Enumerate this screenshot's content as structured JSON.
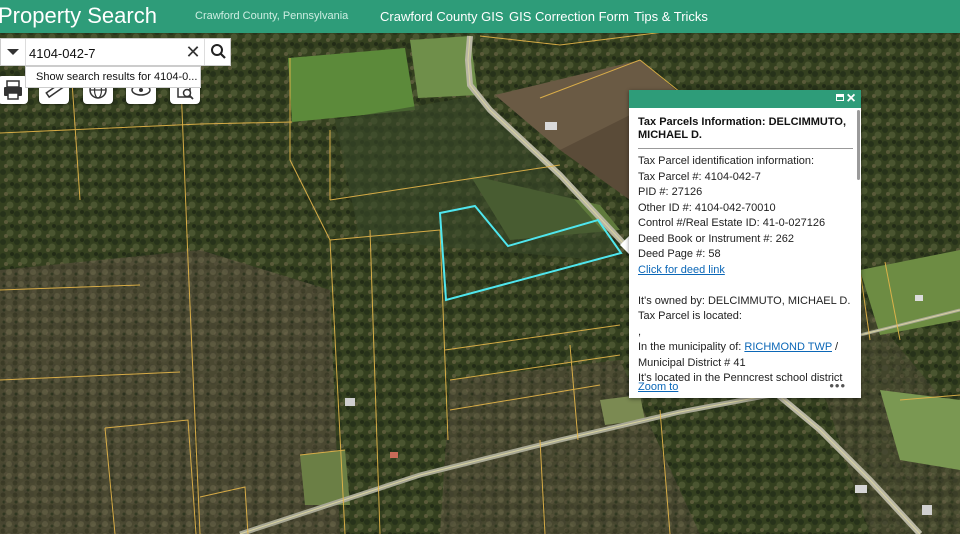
{
  "header": {
    "app_title": "Property Search",
    "subtitle": "Crawford County, Pennsylvania",
    "nav": [
      "Crawford County GIS",
      "GIS Correction Form",
      "Tips & Tricks"
    ],
    "accent": "#2e9c79"
  },
  "search": {
    "value": "4104-042-7",
    "clear_glyph": "✕",
    "suggestion": "Show search results for 4104-0..."
  },
  "tools": [
    "print-icon",
    "measure-icon",
    "basemap-icon",
    "layers-icon",
    "query-icon"
  ],
  "popup": {
    "title": "Tax Parcels Information: DELCIMMUTO, MICHAEL D.",
    "lines": {
      "heading": "Tax Parcel identification information:",
      "tax_parcel_label": "Tax Parcel #: ",
      "tax_parcel_value": "4104-042-7",
      "pid_label": "PID #: ",
      "pid_value": "27126",
      "other_id_label": "Other ID #: ",
      "other_id_value": "4104-042-70010",
      "control_label": "Control #/Real Estate ID: ",
      "control_value": "41-0-027126",
      "deed_book_label": "Deed Book or Instrument #: ",
      "deed_book_value": "262",
      "deed_page_label": "Deed Page #: ",
      "deed_page_value": "58",
      "deed_link": "Click for deed link",
      "owner_label": "It's owned by: ",
      "owner_value": "DELCIMMUTO, MICHAEL D.",
      "located_label": "Tax Parcel is located:",
      "comma": ",",
      "municipality_label": "In the municipality of: ",
      "municipality_value": "RICHMOND TWP",
      "municipality_sep": " /",
      "district_label": "Municipal District # ",
      "district_value": "41",
      "school_line": "It's located in the Penncrest school district"
    },
    "zoom_link": "Zoom to",
    "more": "•••"
  }
}
